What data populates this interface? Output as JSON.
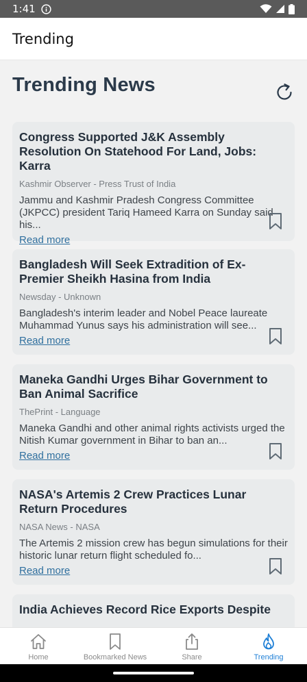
{
  "status_bar": {
    "time": "1:41"
  },
  "app_bar": {
    "title": "Trending"
  },
  "page": {
    "heading": "Trending News"
  },
  "articles": [
    {
      "title": "Congress Supported J&K Assembly Resolution On Statehood For Land, Jobs: Karra",
      "source": "Kashmir Observer - Press Trust of India",
      "description": "Jammu and Kashmir Pradesh Congress Committee (JKPCC) president Tariq Hameed Karra on Sunday said his...",
      "read_more": "Read more"
    },
    {
      "title": "Bangladesh Will Seek Extradition of Ex-Premier Sheikh Hasina from India",
      "source": "Newsday - Unknown",
      "description": "Bangladesh's interim leader and Nobel Peace laureate Muhammad Yunus says his administration will see...",
      "read_more": "Read more"
    },
    {
      "title": "Maneka Gandhi Urges Bihar Government to Ban Animal Sacrifice",
      "source": "ThePrint - Language",
      "description": "Maneka Gandhi and other animal rights activists urged the Nitish Kumar government in Bihar to ban an...",
      "read_more": "Read more"
    },
    {
      "title": "NASA's Artemis 2 Crew Practices Lunar Return Procedures",
      "source": "NASA News - NASA",
      "description": "The Artemis 2 mission crew has begun simulations for their historic lunar return flight scheduled fo...",
      "read_more": "Read more"
    },
    {
      "title": "India Achieves Record Rice Exports Despite"
    }
  ],
  "bottom_nav": [
    {
      "label": "Home",
      "icon": "home-icon"
    },
    {
      "label": "Bookmarked News",
      "icon": "bookmark-icon"
    },
    {
      "label": "Share",
      "icon": "share-icon"
    },
    {
      "label": "Trending",
      "icon": "flame-icon",
      "active": true
    }
  ],
  "colors": {
    "accent": "#1e7fd6",
    "heading": "#2b3a4a",
    "link": "#2f6f9e"
  }
}
